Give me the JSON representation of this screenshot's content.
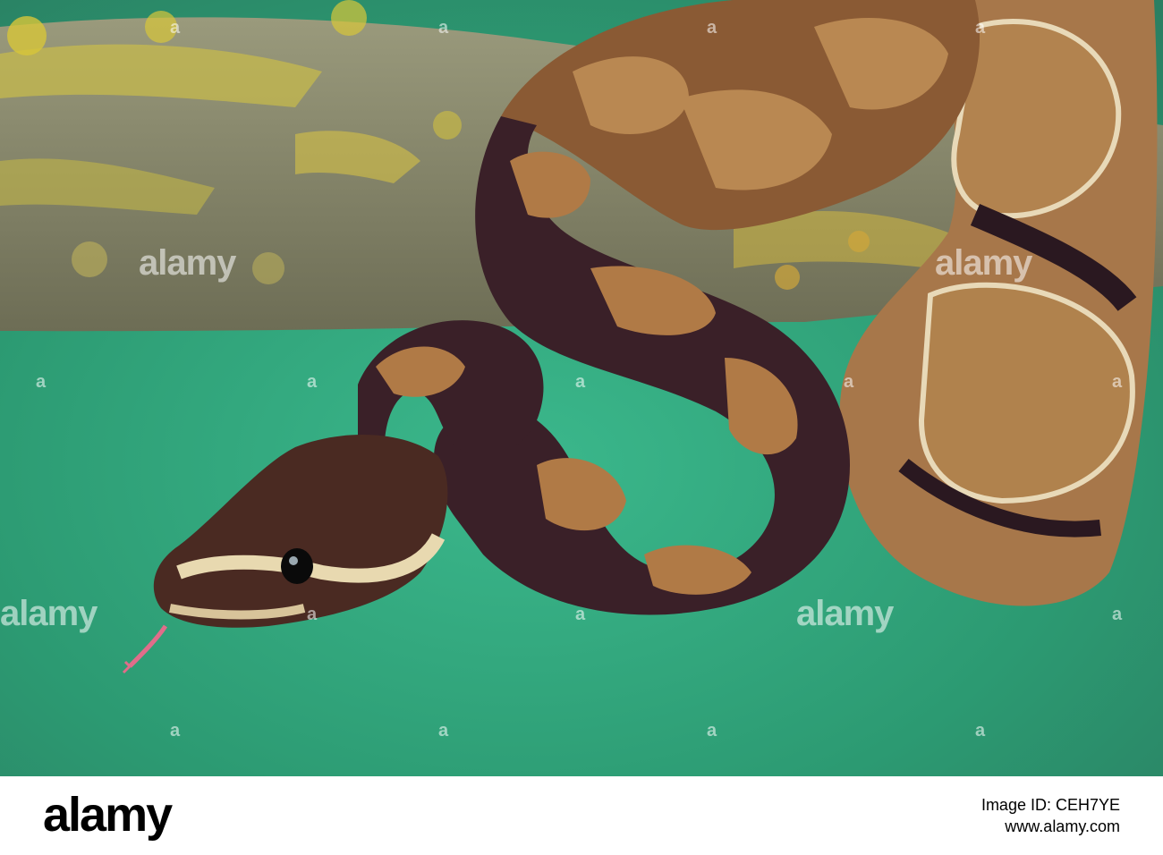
{
  "watermark": {
    "word": "alamy",
    "dot": "a"
  },
  "footer": {
    "logo": "alamy",
    "image_id": "Image ID: CEH7YE",
    "site": "www.alamy.com"
  },
  "colors": {
    "background": "#2fa580",
    "branch": "#8a8a72",
    "lichen": "#d8c640",
    "snake_dark": "#2a1820",
    "snake_tan": "#a86f3e"
  }
}
